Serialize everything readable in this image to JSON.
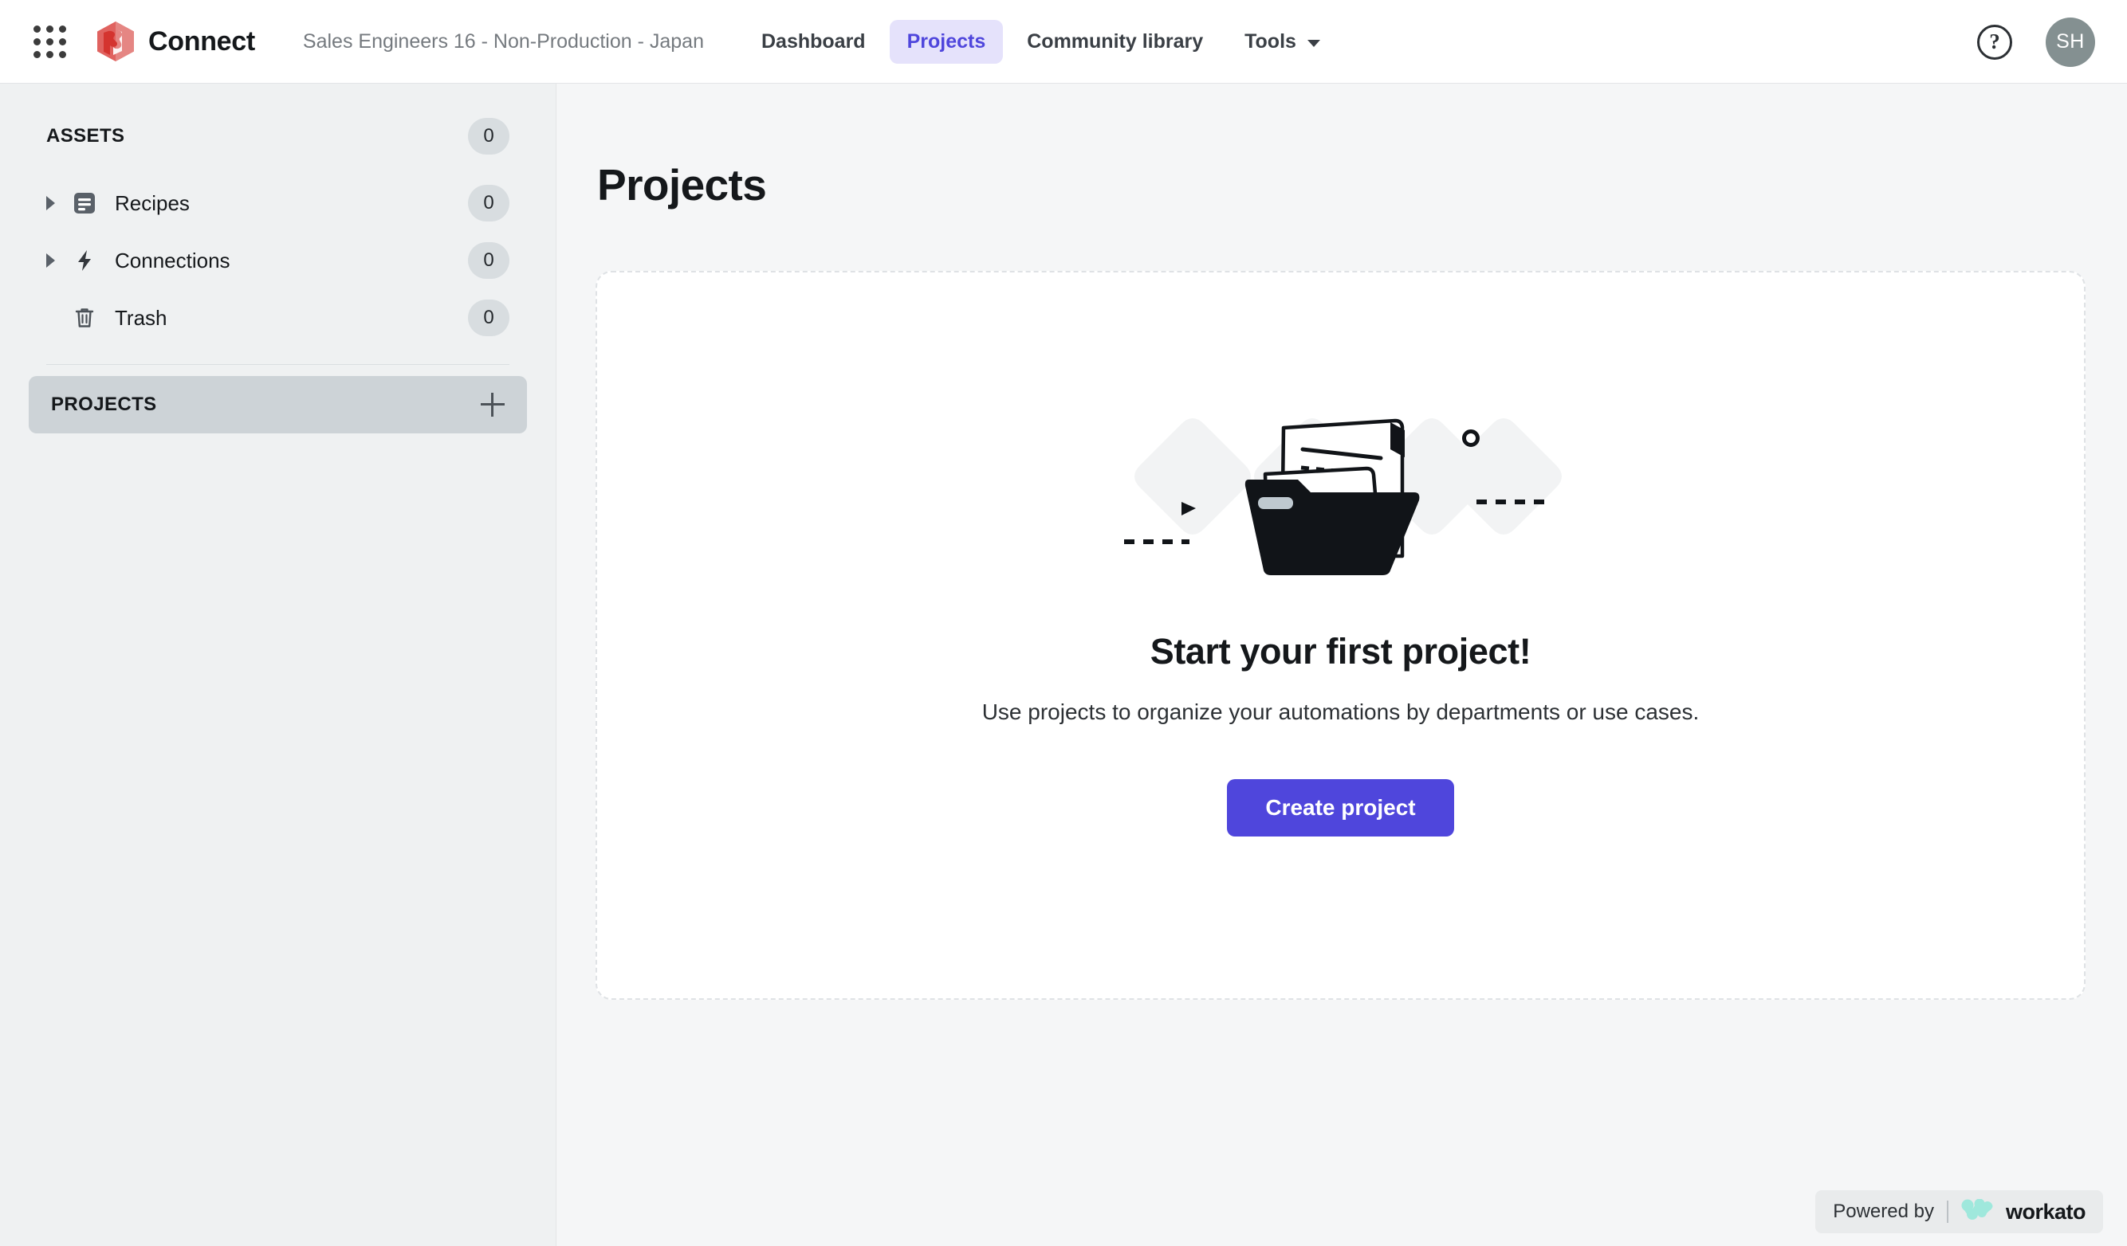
{
  "topbar": {
    "apps_icon": "grid-apps-icon",
    "brand_logo_icon": "workato-hexagon-logo",
    "brand_name": "Connect",
    "breadcrumb": "Sales Engineers 16 - Non-Production - Japan",
    "nav": [
      {
        "label": "Dashboard",
        "active": false,
        "has_chevron": false
      },
      {
        "label": "Projects",
        "active": true,
        "has_chevron": false
      },
      {
        "label": "Community library",
        "active": false,
        "has_chevron": false
      },
      {
        "label": "Tools",
        "active": false,
        "has_chevron": true
      }
    ],
    "help_icon": "question-mark-circle-icon",
    "help_glyph": "?",
    "avatar_initials": "SH",
    "avatar_color": "#849091",
    "active_nav_bg": "#E5E2FB",
    "active_nav_color": "#4F46DC"
  },
  "sidebar": {
    "assets_label": "ASSETS",
    "assets_count": "0",
    "items": [
      {
        "label": "Recipes",
        "count": "0",
        "icon": "recipe-document-icon",
        "has_disclosure": true
      },
      {
        "label": "Connections",
        "count": "0",
        "icon": "lightning-bolt-icon",
        "has_disclosure": true
      },
      {
        "label": "Trash",
        "count": "0",
        "icon": "trash-can-icon",
        "has_disclosure": false
      }
    ],
    "projects_label": "PROJECTS",
    "add_project_icon": "plus-icon",
    "background": "#EFF1F2",
    "projects_header_bg": "#CDD3D7",
    "badge_bg": "#D8DDE0"
  },
  "main": {
    "page_title": "Projects",
    "empty_state": {
      "illustration": "open-folder-with-documents-illustration",
      "title": "Start your first project!",
      "subtitle": "Use projects to organize your automations by departments or use cases.",
      "button_label": "Create project",
      "button_color": "#4F46DC"
    }
  },
  "footer": {
    "powered_by_text": "Powered by",
    "workato_logo_icon": "workato-w-logo",
    "workato_name": "workato",
    "workato_logo_color": "#9FE8DC"
  }
}
